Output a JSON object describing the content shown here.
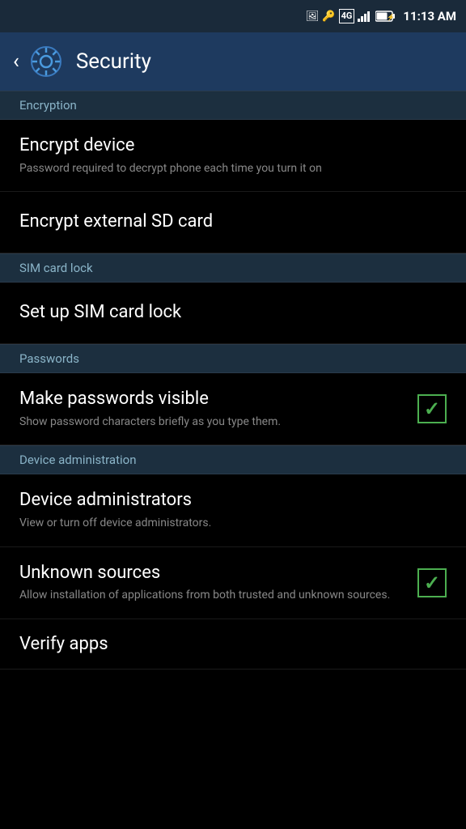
{
  "statusBar": {
    "time": "11:13 AM",
    "battery": "70%",
    "network": "4G"
  },
  "navBar": {
    "title": "Security",
    "backLabel": "‹"
  },
  "sections": [
    {
      "id": "encryption",
      "header": "Encryption",
      "items": [
        {
          "id": "encrypt-device",
          "title": "Encrypt device",
          "subtitle": "Password required to decrypt phone each time you turn it on",
          "hasCheckbox": false
        },
        {
          "id": "encrypt-sd",
          "title": "Encrypt external SD card",
          "subtitle": "",
          "hasCheckbox": false
        }
      ]
    },
    {
      "id": "sim-card-lock",
      "header": "SIM card lock",
      "items": [
        {
          "id": "setup-sim-lock",
          "title": "Set up SIM card lock",
          "subtitle": "",
          "hasCheckbox": false
        }
      ]
    },
    {
      "id": "passwords",
      "header": "Passwords",
      "items": [
        {
          "id": "make-passwords-visible",
          "title": "Make passwords visible",
          "subtitle": "Show password characters briefly as you type them.",
          "hasCheckbox": true,
          "checked": true
        }
      ]
    },
    {
      "id": "device-administration",
      "header": "Device administration",
      "items": [
        {
          "id": "device-administrators",
          "title": "Device administrators",
          "subtitle": "View or turn off device administrators.",
          "hasCheckbox": false
        },
        {
          "id": "unknown-sources",
          "title": "Unknown sources",
          "subtitle": "Allow installation of applications from both trusted and unknown sources.",
          "hasCheckbox": true,
          "checked": true
        }
      ]
    }
  ],
  "partialItem": {
    "title": "Verify apps"
  },
  "icons": {
    "gear": "⚙",
    "back": "‹",
    "check": "✓"
  }
}
